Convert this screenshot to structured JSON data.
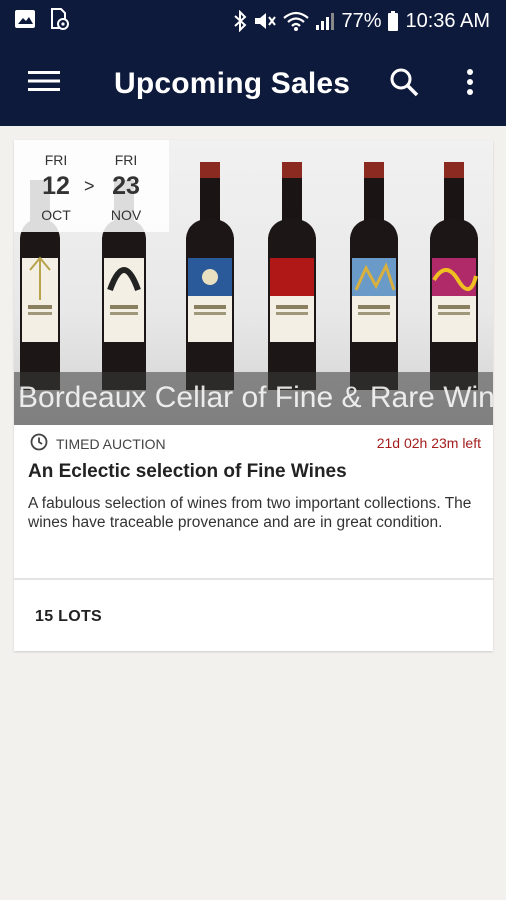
{
  "status_bar": {
    "battery": "77%",
    "time": "10:36 AM",
    "icons": [
      "image-icon",
      "sim-settings-icon",
      "bluetooth-icon",
      "mute-icon",
      "wifi-icon",
      "signal-icon",
      "battery-icon"
    ]
  },
  "app_bar": {
    "title": "Upcoming Sales",
    "icons": [
      "menu-icon",
      "search-icon",
      "more-vertical-icon"
    ]
  },
  "sale": {
    "start": {
      "dow": "FRI",
      "day": "12",
      "month": "OCT"
    },
    "arrow": ">",
    "end": {
      "dow": "FRI",
      "day": "23",
      "month": "NOV"
    },
    "image_caption": "Bordeaux Cellar of Fine & Rare Wines",
    "type": "TIMED AUCTION",
    "time_left": "21d 02h 23m left",
    "title": "An Eclectic selection of Fine Wines",
    "description": "A fabulous selection of wines from two important collections. The wines have traceable provenance and are in great condition.",
    "lots": "15 LOTS"
  },
  "colors": {
    "app_bar": "#0e1a3c",
    "background": "#f2f1ee",
    "time_left": "#a31d1d"
  }
}
